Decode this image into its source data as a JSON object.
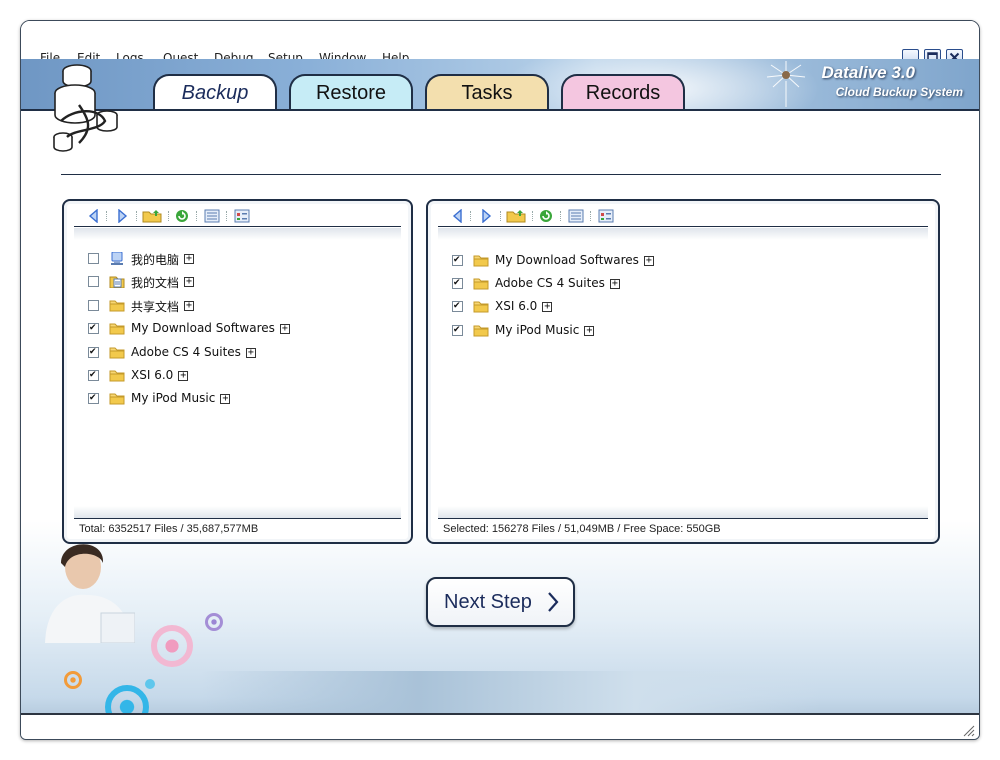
{
  "menu": [
    "File",
    "Edit",
    "Logs",
    "Quest",
    "Debug",
    "Setup",
    "Window",
    "Help"
  ],
  "tabs": [
    {
      "label": "Backup",
      "color": "#ffffff"
    },
    {
      "label": "Restore",
      "color": "#c6ecf6"
    },
    {
      "label": "Tasks",
      "color": "#f3dfae"
    },
    {
      "label": "Records",
      "color": "#f4c6e0"
    }
  ],
  "brand": {
    "title": "Datalive 3.0",
    "subtitle": "Cloud Buckup System"
  },
  "left_panel": {
    "items": [
      {
        "label": "我的电脑",
        "checked": false,
        "icon": "computer-icon"
      },
      {
        "label": "我的文档",
        "checked": false,
        "icon": "documents-icon"
      },
      {
        "label": "共享文档",
        "checked": false,
        "icon": "folder-icon"
      },
      {
        "label": "My Download Softwares",
        "checked": true,
        "icon": "folder-icon"
      },
      {
        "label": "Adobe CS 4 Suites",
        "checked": true,
        "icon": "folder-icon"
      },
      {
        "label": "XSI 6.0",
        "checked": true,
        "icon": "folder-icon"
      },
      {
        "label": "My iPod Music",
        "checked": true,
        "icon": "folder-icon"
      }
    ],
    "status": "Total: 6352517 Files / 35,687,577MB"
  },
  "right_panel": {
    "items": [
      {
        "label": "My Download Softwares",
        "checked": true,
        "icon": "folder-icon"
      },
      {
        "label": "Adobe CS 4 Suites",
        "checked": true,
        "icon": "folder-icon"
      },
      {
        "label": "XSI 6.0",
        "checked": true,
        "icon": "folder-icon"
      },
      {
        "label": "My iPod Music",
        "checked": true,
        "icon": "folder-icon"
      }
    ],
    "status": "Selected: 156278 Files / 51,049MB / Free Space: 550GB"
  },
  "next_button": {
    "label": "Next Step"
  },
  "colors": {
    "accent": "#1f2e45",
    "folder": "#f2c94c",
    "refresh": "#3aa63a",
    "nav_arrow": "#3b6fd1"
  }
}
